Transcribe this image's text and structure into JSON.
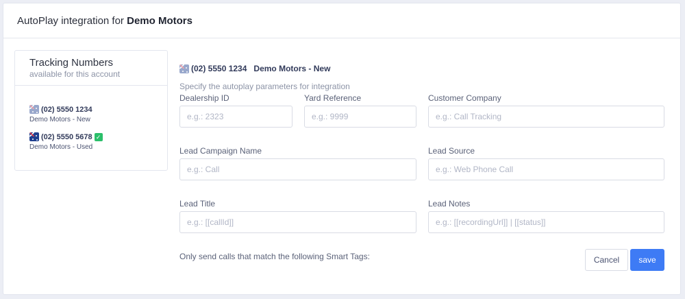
{
  "header": {
    "title_prefix": "AutoPlay integration for",
    "account_name": "Demo Motors"
  },
  "tracking_numbers": {
    "title": "Tracking Numbers",
    "subtitle": "available for this account",
    "items": [
      {
        "number": "(02) 5550 1234",
        "name": "Demo Motors - New",
        "flag": "au-flag-icon",
        "selected": true,
        "configured": false
      },
      {
        "number": "(02) 5550 5678",
        "name": "Demo Motors - Used",
        "flag": "au-flag-icon",
        "selected": false,
        "configured": true,
        "status_icon": "checkmark-icon"
      }
    ]
  },
  "form": {
    "selected_number": "(02) 5550 1234",
    "selected_name": "Demo Motors - New",
    "intro": "Specify the autoplay parameters for integration",
    "fields": {
      "dealership_id": {
        "label": "Dealership ID",
        "placeholder": "e.g.: 2323",
        "value": ""
      },
      "yard_reference": {
        "label": "Yard Reference",
        "placeholder": "e.g.: 9999",
        "value": ""
      },
      "customer_company": {
        "label": "Customer Company",
        "placeholder": "e.g.: Call Tracking",
        "value": ""
      },
      "lead_campaign_name": {
        "label": "Lead Campaign Name",
        "placeholder": "e.g.: Call",
        "value": ""
      },
      "lead_source": {
        "label": "Lead Source",
        "placeholder": "e.g.: Web Phone Call",
        "value": ""
      },
      "lead_title": {
        "label": "Lead Title",
        "placeholder": "e.g.: [[callId]]",
        "value": ""
      },
      "lead_notes": {
        "label": "Lead Notes",
        "placeholder": "e.g.: [[recordingUrl]] | [[status]]",
        "value": ""
      }
    },
    "smart_tags_note": "Only send calls that match the following Smart Tags:",
    "cancel_label": "Cancel",
    "save_label": "save"
  },
  "colors": {
    "primary": "#3e7bf5",
    "success": "#2bbf6a",
    "background": "#eceef5"
  }
}
